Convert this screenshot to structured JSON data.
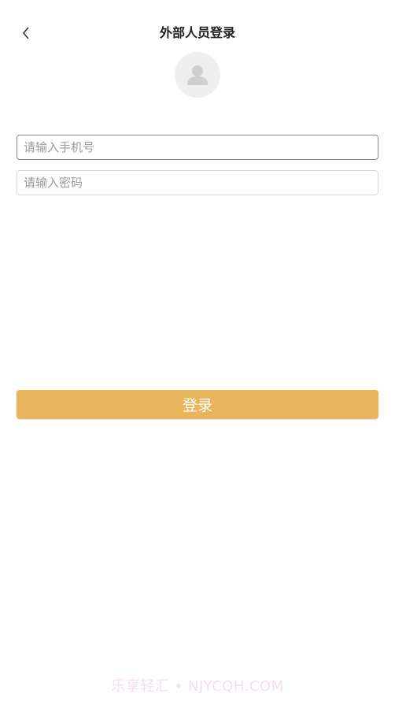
{
  "header": {
    "title": "外部人员登录",
    "back_icon": "chevron-left-icon"
  },
  "avatar": {
    "icon": "user-avatar-icon"
  },
  "form": {
    "phone_placeholder": "请输入手机号",
    "password_placeholder": "请输入密码",
    "login_label": "登录"
  },
  "watermark": "乐享轻汇 • NJYCQH.COM",
  "colors": {
    "accent": "#e9b55c",
    "avatar_bg": "#efefef"
  }
}
